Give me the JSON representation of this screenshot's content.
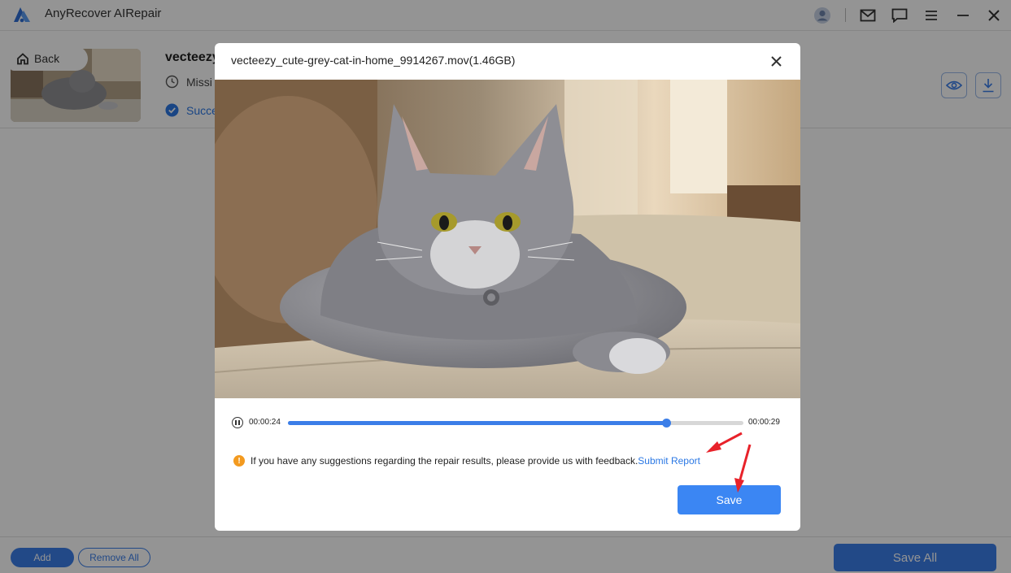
{
  "app": {
    "title": "AnyRecover AIRepair",
    "brand_color": "#3b7ee8"
  },
  "titlebar": {
    "icons": [
      "user-icon",
      "mail-icon",
      "chat-icon",
      "menu-icon",
      "minimize-icon",
      "close-icon"
    ]
  },
  "file_row": {
    "back_label": "Back",
    "file_name": "vecteezy_",
    "status_missing": "Missi",
    "status_success": "Succe"
  },
  "bottom_bar": {
    "add_label": "Add",
    "remove_all_label": "Remove All",
    "save_all_label": "Save All"
  },
  "modal": {
    "title": "vecteezy_cute-grey-cat-in-home_9914267.mov(1.46GB)",
    "current_time": "00:00:24",
    "total_time": "00:00:29",
    "progress_fraction": 0.83,
    "notice_text": "If you have any suggestions regarding the repair results, please provide us with feedback.",
    "submit_link": "Submit Report",
    "save_label": "Save"
  }
}
